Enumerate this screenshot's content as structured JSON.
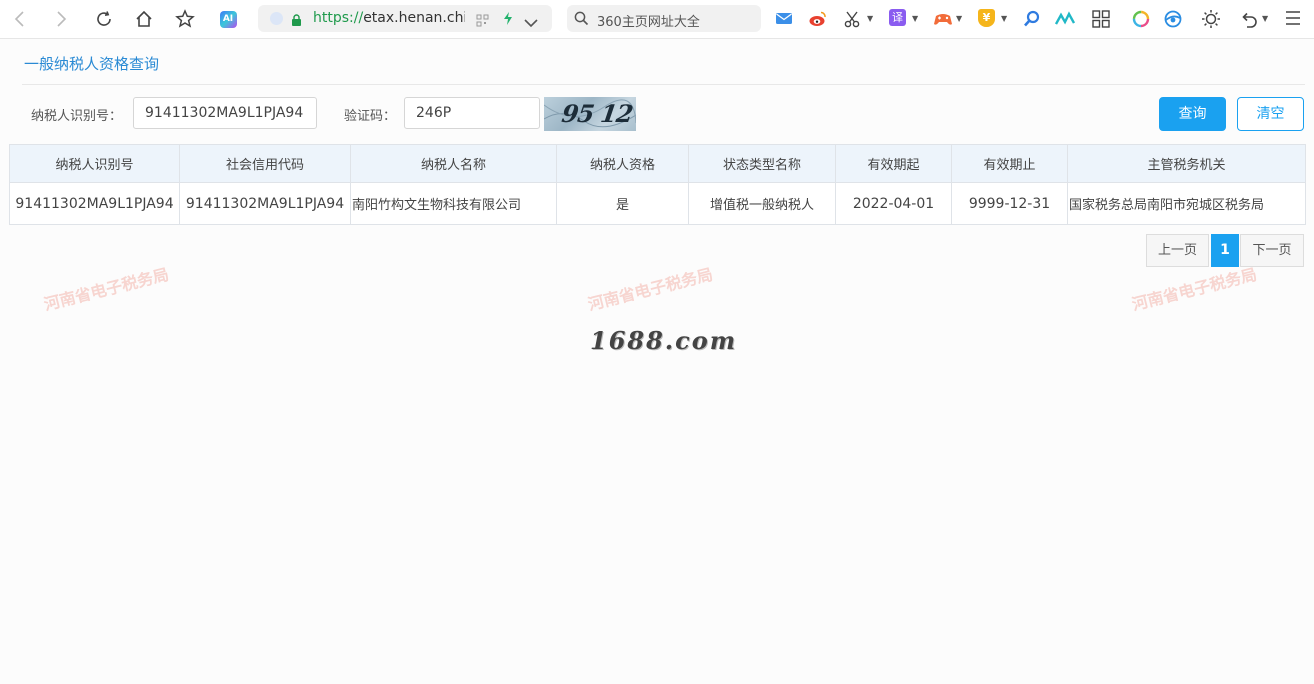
{
  "browser": {
    "url_scheme": "https://",
    "url_host": "etax.henan.chir",
    "search_placeholder": "360主页网址大全",
    "ai_badge": "AI",
    "translate_badge": "译",
    "yen_badge": "¥"
  },
  "page": {
    "title": "一般纳税人资格查询"
  },
  "form": {
    "taxpayer_id_label": "纳税人识别号：",
    "taxpayer_id_value": "91411302MA9L1PJA94",
    "captcha_label": "验证码：",
    "captcha_value": "246P",
    "captcha_image_text": "95 12",
    "query_button": "查询",
    "clear_button": "清空"
  },
  "table": {
    "headers": [
      "纳税人识别号",
      "社会信用代码",
      "纳税人名称",
      "纳税人资格",
      "状态类型名称",
      "有效期起",
      "有效期止",
      "主管税务机关"
    ],
    "rows": [
      [
        "91411302MA9L1PJA94",
        "91411302MA9L1PJA94",
        "南阳竹构文生物科技有限公司",
        "是",
        "增值税一般纳税人",
        "2022-04-01",
        "9999-12-31",
        "国家税务总局南阳市宛城区税务局"
      ]
    ]
  },
  "pager": {
    "prev": "上一页",
    "current": "1",
    "next": "下一页"
  },
  "watermarks": {
    "text": "河南省电子税务局",
    "logo": "1688.com"
  },
  "colors": {
    "accent": "#1aa1f0",
    "title": "#2a8ad4",
    "header_bg": "#edf4fb",
    "watermark": "#eb6e5f"
  }
}
